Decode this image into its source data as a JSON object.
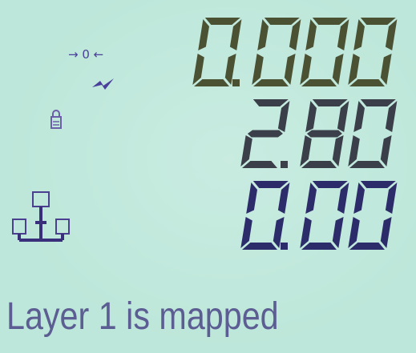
{
  "display": {
    "background": "#bde7da",
    "segment_color_top": "#4b5234",
    "segment_color_mid": "#3a3f4a",
    "segment_color_bottom": "#2d2c6a",
    "icon_color": "#4a3f9a"
  },
  "indicators": {
    "zero_icon": "→ 0 ←",
    "bolt_icon": "lightning-bolt-icon",
    "lock_icon": "lock-icon",
    "network_icon": "network-tree-icon"
  },
  "readouts": [
    {
      "value": "0.000"
    },
    {
      "value": "2.80"
    },
    {
      "value": "0.00"
    }
  ],
  "status_message": "Layer 1 is mapped"
}
